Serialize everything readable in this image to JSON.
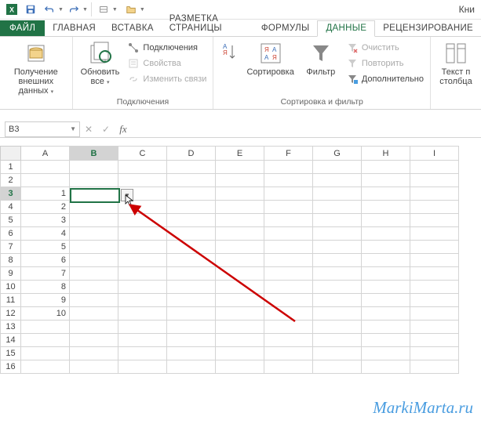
{
  "qat": {
    "title": "Кни"
  },
  "tabs": {
    "file": "ФАЙЛ",
    "items": [
      "ГЛАВНАЯ",
      "ВСТАВКА",
      "РАЗМЕТКА СТРАНИЦЫ",
      "ФОРМУЛЫ",
      "ДАННЫЕ",
      "РЕЦЕНЗИРОВАНИЕ"
    ],
    "active_index": 4
  },
  "ribbon": {
    "group1": {
      "big_label": "Получение\nвнешних данных",
      "caption": ""
    },
    "group2": {
      "big_label": "Обновить\nвсе",
      "items": [
        "Подключения",
        "Свойства",
        "Изменить связи"
      ],
      "caption": "Подключения"
    },
    "group3": {
      "big_label": "Сортировка",
      "filter_label": "Фильтр",
      "items": [
        "Очистить",
        "Повторить",
        "Дополнительно"
      ],
      "caption": "Сортировка и фильтр"
    },
    "group4": {
      "big_label": "Текст п\nстолбца"
    }
  },
  "namebox": {
    "value": "B3"
  },
  "formula": {
    "value": ""
  },
  "grid": {
    "columns": [
      "A",
      "B",
      "C",
      "D",
      "E",
      "F",
      "G",
      "H",
      "I"
    ],
    "rows": [
      "1",
      "2",
      "3",
      "4",
      "5",
      "6",
      "7",
      "8",
      "9",
      "10",
      "11",
      "12",
      "13",
      "14",
      "15",
      "16"
    ],
    "active_col": "B",
    "active_row": "3",
    "data": {
      "A3": "1",
      "A4": "2",
      "A5": "3",
      "A6": "4",
      "A7": "5",
      "A8": "6",
      "A9": "7",
      "A10": "8",
      "A11": "9",
      "A12": "10"
    }
  },
  "watermark": "MarkiMarta.ru"
}
